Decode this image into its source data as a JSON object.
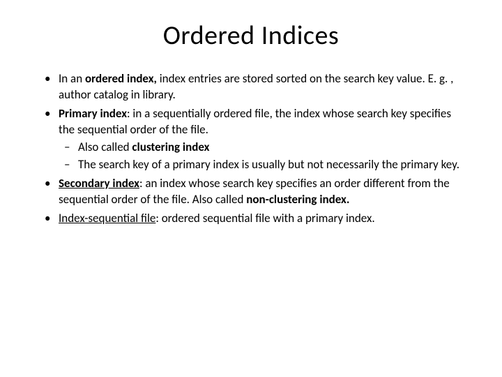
{
  "title": "Ordered Indices",
  "bullets": {
    "b1": {
      "pre": "In an ",
      "bold": "ordered index,",
      "post": " index entries are stored sorted on the search key value.  E. g. , author catalog in library."
    },
    "b2": {
      "bold": "Primary index",
      "post": ": in a sequentially ordered file, the index whose search key specifies the sequential order of the file.",
      "sub1": {
        "pre": "Also called ",
        "bold": "clustering index"
      },
      "sub2": "The search key of a primary index is usually but not necessarily the primary key."
    },
    "b3": {
      "bold_u": "Secondary index",
      "mid": ": an index whose search key specifies an order different from the sequential order of the file.  Also called ",
      "bold2": "non-clustering index",
      "period": "."
    },
    "b4": {
      "u": "Index-sequential file",
      "post": ": ordered sequential file with a primary index."
    }
  }
}
